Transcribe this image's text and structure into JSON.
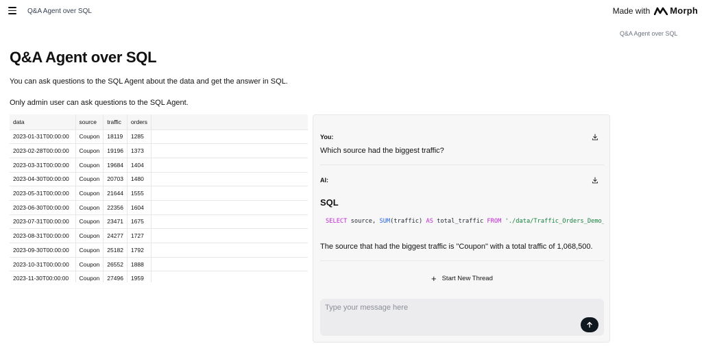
{
  "header": {
    "app_title": "Q&A Agent over SQL",
    "made_with_label": "Made with",
    "brand_name": "Morph"
  },
  "toc": {
    "link_label": "Q&A Agent over SQL"
  },
  "page": {
    "title": "Q&A Agent over SQL",
    "description_1": "You can ask questions to the SQL Agent about the data and get the answer in SQL.",
    "description_2": "Only admin user can ask questions to the SQL Agent."
  },
  "table": {
    "columns": [
      "data",
      "source",
      "traffic",
      "orders"
    ],
    "rows": [
      [
        "2023-01-31T00:00:00",
        "Coupon",
        "18119",
        "1285"
      ],
      [
        "2023-02-28T00:00:00",
        "Coupon",
        "19196",
        "1373"
      ],
      [
        "2023-03-31T00:00:00",
        "Coupon",
        "19684",
        "1404"
      ],
      [
        "2023-04-30T00:00:00",
        "Coupon",
        "20703",
        "1480"
      ],
      [
        "2023-05-31T00:00:00",
        "Coupon",
        "21644",
        "1555"
      ],
      [
        "2023-06-30T00:00:00",
        "Coupon",
        "22356",
        "1604"
      ],
      [
        "2023-07-31T00:00:00",
        "Coupon",
        "23471",
        "1675"
      ],
      [
        "2023-08-31T00:00:00",
        "Coupon",
        "24277",
        "1727"
      ],
      [
        "2023-09-30T00:00:00",
        "Coupon",
        "25182",
        "1792"
      ],
      [
        "2023-10-31T00:00:00",
        "Coupon",
        "26552",
        "1888"
      ],
      [
        "2023-11-30T00:00:00",
        "Coupon",
        "27496",
        "1959"
      ]
    ]
  },
  "chat": {
    "user_label": "You:",
    "user_message": "Which source had the biggest traffic?",
    "ai_label": "AI:",
    "sql_heading": "SQL",
    "sql": {
      "kw_select": "SELECT",
      "col_source": " source, ",
      "fn_sum": "SUM",
      "sum_arg": "(traffic) ",
      "kw_as": "AS",
      "alias": " total_traffic ",
      "kw_from": "FROM",
      "table_path": " './data/Traffic_Orders_Demo_Data.csv' "
    },
    "ai_answer": "The source that had the biggest traffic is \"Coupon\" with a total traffic of 1,068,500.",
    "new_thread_label": "Start New Thread",
    "input_placeholder": "Type your message here",
    "input_value": ""
  },
  "icons": {
    "menu": "hamburger-menu-icon",
    "brand": "morph-logo-icon",
    "download": "download-icon",
    "plus": "plus-icon",
    "send": "arrow-up-icon"
  },
  "colors": {
    "sql_keyword": "#c026d3",
    "sql_function": "#2563eb",
    "sql_string": "#15803d",
    "send_button": "#101820",
    "chat_background": "#f7f7f8"
  }
}
